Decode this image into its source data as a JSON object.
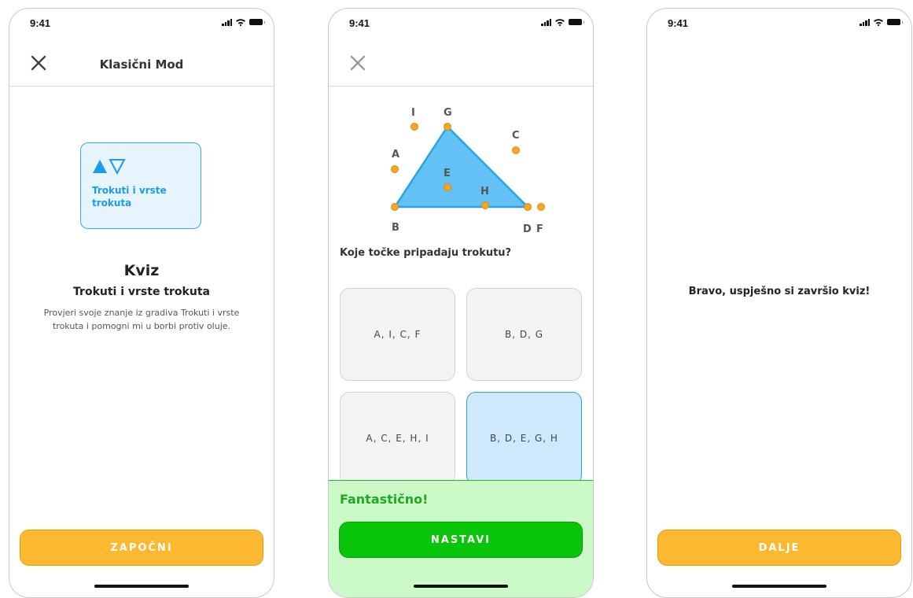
{
  "status": {
    "time": "9:41"
  },
  "screen1": {
    "header_title": "Klasični Mod",
    "card_label": "Trokuti i vrste trokuta",
    "quiz_title": "Kviz",
    "quiz_subtitle": "Trokuti i vrste trokuta",
    "quiz_description": "Provjeri svoje znanje iz gradiva Trokuti i vrste trokuta i pomogni mi u borbi protiv oluje.",
    "start_button": "ZAPOČNI"
  },
  "screen2": {
    "diagram_points": {
      "I": "I",
      "G": "G",
      "C": "C",
      "A": "A",
      "E": "E",
      "H": "H",
      "B": "B",
      "D": "D",
      "F": "F"
    },
    "question": "Koje točke pripadaju trokutu?",
    "options": [
      "A, I, C, F",
      "B, D, G",
      "A, C, E, H, I",
      "B, D, E, G, H"
    ],
    "selected_option": "B, D, E, G, H",
    "feedback": "Fantastično!",
    "continue_button": "NASTAVI"
  },
  "screen3": {
    "message": "Bravo, uspješno si završio kviz!",
    "next_button": "DALJE"
  },
  "colors": {
    "orange": "#fbb830",
    "green": "#09c509",
    "blue": "#3aa6ea",
    "triangle_fill": "#63c2f5",
    "point": "#f5a623"
  }
}
